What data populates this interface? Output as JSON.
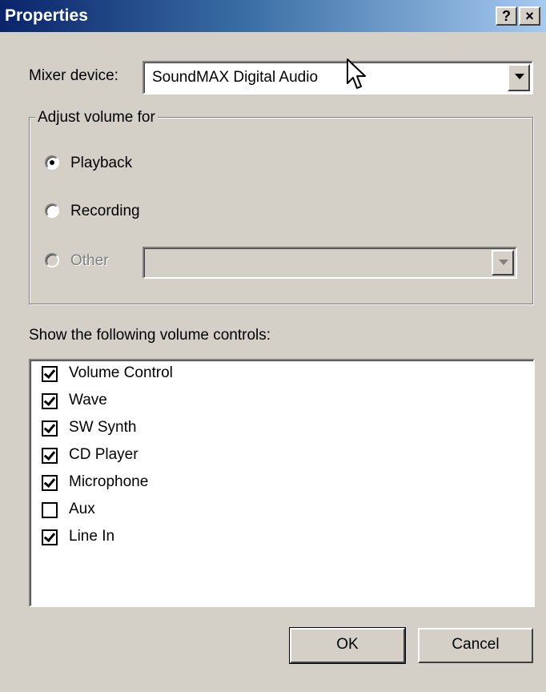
{
  "window": {
    "title": "Properties",
    "help_label": "?",
    "close_label": "×"
  },
  "mixer": {
    "label": "Mixer device:",
    "value": "SoundMAX Digital Audio"
  },
  "adjust": {
    "legend": "Adjust volume for",
    "options": [
      {
        "label": "Playback",
        "checked": true,
        "enabled": true
      },
      {
        "label": "Recording",
        "checked": false,
        "enabled": true
      },
      {
        "label": "Other",
        "checked": false,
        "enabled": false
      }
    ],
    "other_value": ""
  },
  "controls": {
    "label": "Show the following volume controls:",
    "items": [
      {
        "label": "Volume Control",
        "checked": true
      },
      {
        "label": "Wave",
        "checked": true
      },
      {
        "label": "SW Synth",
        "checked": true
      },
      {
        "label": "CD Player",
        "checked": true
      },
      {
        "label": "Microphone",
        "checked": true
      },
      {
        "label": "Aux",
        "checked": false
      },
      {
        "label": "Line In",
        "checked": true
      }
    ]
  },
  "buttons": {
    "ok": "OK",
    "cancel": "Cancel"
  }
}
